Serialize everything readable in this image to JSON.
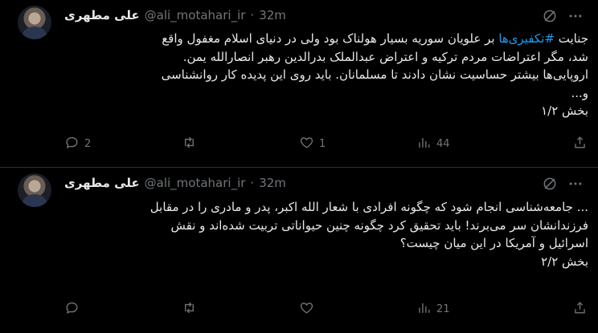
{
  "tweets": [
    {
      "author_name": "علی مطهری",
      "handle": "@ali_motahari_ir",
      "dot": "·",
      "time": "32m",
      "hashtag": "#تکفیری‌ها",
      "lines": [
        "جنایت ",
        " بر علویان سوریه بسیار هولناک بود ولی در دنیای اسلام مغفول واقع",
        "شد، مگر اعتراضات مردم ترکیه و اعتراض عبدالملک بدرالدین رهبر انصارالله یمن.",
        "اروپایی‌ها بیشتر حساسیت نشان دادند تا مسلمانان. باید روی این پدیده کار روانشناسی",
        "و...",
        "بخش ۱/۲"
      ],
      "replies": "2",
      "retweets": "",
      "likes": "1",
      "views": "44"
    },
    {
      "author_name": "علی مطهری",
      "handle": "@ali_motahari_ir",
      "dot": "·",
      "time": "32m",
      "lines": [
        "... جامعه‌شناسی انجام شود که چگونه افرادی با شعار الله اکبر، پدر و مادری را در مقابل",
        "فرزندانشان سر می‌برند! باید تحقیق کرد چگونه چنین حیواناتی تربیت شده‌اند و نقش",
        "اسرائیل و آمریکا در این میان چیست؟",
        "بخش ۲/۲"
      ],
      "replies": "",
      "retweets": "",
      "likes": "",
      "views": "21"
    }
  ],
  "icons": {
    "grok": "grok-icon",
    "more": "more-icon",
    "reply": "reply-icon",
    "retweet": "retweet-icon",
    "like": "like-icon",
    "views": "views-icon",
    "share": "share-icon"
  },
  "colors": {
    "background": "#000000",
    "text": "#e7e9ea",
    "muted": "#71767b",
    "link": "#1d9bf0",
    "divider": "#2f3336"
  }
}
